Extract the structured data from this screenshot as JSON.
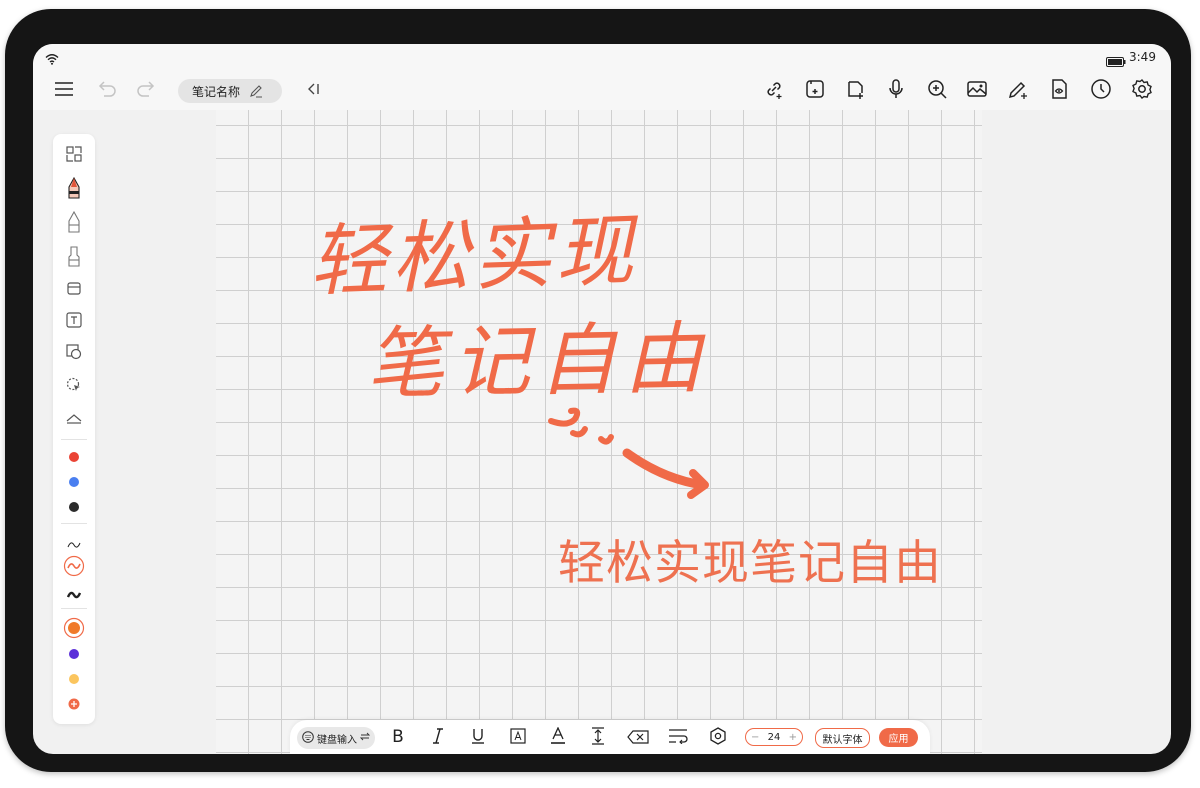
{
  "status_bar": {
    "time": "3:49"
  },
  "header": {
    "note_name": "笔记名称"
  },
  "canvas": {
    "handwritten_line_1": "轻松实现",
    "handwritten_line_2": "笔记自由",
    "typed_text": "轻松实现笔记自由"
  },
  "sidebar": {
    "colors": [
      "#ea4335",
      "#4a7ff0",
      "#2b2b2b"
    ],
    "palette": [
      "#f07a2a",
      "#5b2fd9",
      "#fbc55e",
      "#f06a48"
    ]
  },
  "text_toolbar": {
    "keyboard_input_label": "键盘输入",
    "font_size": "24",
    "minus": "−",
    "plus": "+",
    "font_label": "默认字体",
    "apply_label": "应用"
  },
  "colors": {
    "accent": "#f06a48"
  }
}
